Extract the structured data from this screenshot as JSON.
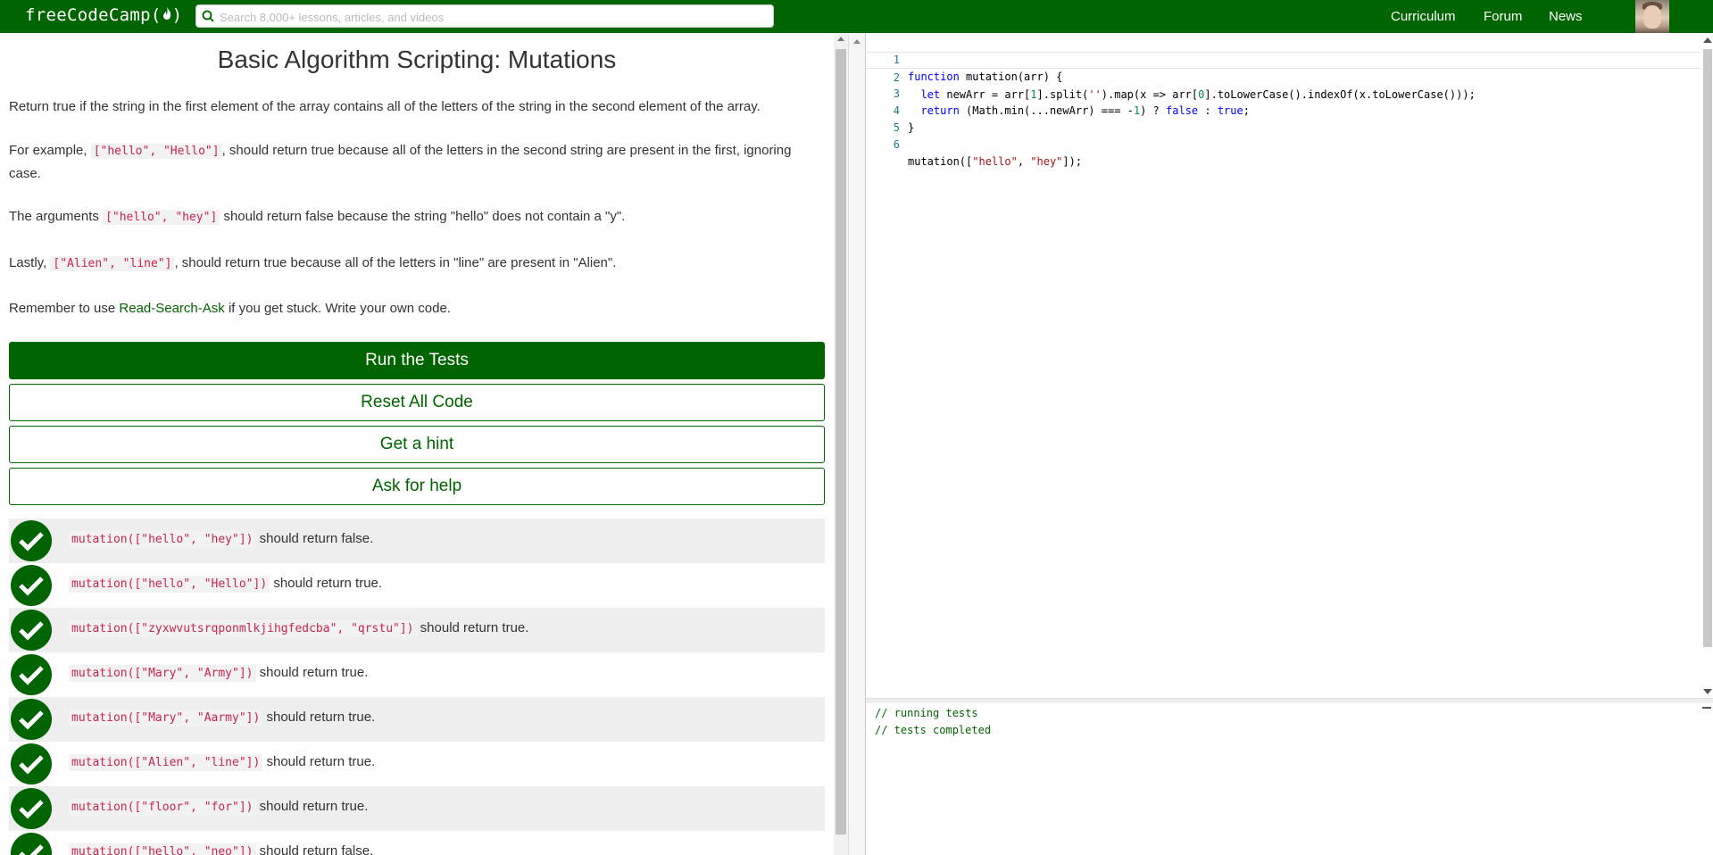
{
  "nav": {
    "logo_text": "freeCodeCamp(",
    "logo_suffix": ")",
    "search_placeholder": "Search 8,000+ lessons, articles, and videos",
    "links": [
      "Curriculum",
      "Forum",
      "News"
    ]
  },
  "challenge": {
    "title": "Basic Algorithm Scripting: Mutations",
    "p1": "Return true if the string in the first element of the array contains all of the letters of the string in the second element of the array.",
    "p2_pre": "For example, ",
    "p2_code": "[\"hello\", \"Hello\"]",
    "p2_post": ", should return true because all of the letters in the second string are present in the first, ignoring case.",
    "p3_pre": "The arguments ",
    "p3_code": "[\"hello\", \"hey\"]",
    "p3_post": " should return false because the string \"hello\" does not contain a \"y\".",
    "p4_pre": "Lastly, ",
    "p4_code": "[\"Alien\", \"line\"]",
    "p4_post": ", should return true because all of the letters in \"line\" are present in \"Alien\".",
    "p5_pre": "Remember to use ",
    "p5_link": "Read-Search-Ask",
    "p5_post": " if you get stuck. Write your own code."
  },
  "buttons": {
    "run": "Run the Tests",
    "reset": "Reset All Code",
    "hint": "Get a hint",
    "help": "Ask for help"
  },
  "tests": [
    {
      "code": "mutation([\"hello\", \"hey\"])",
      "text": " should return false."
    },
    {
      "code": "mutation([\"hello\", \"Hello\"])",
      "text": " should return true."
    },
    {
      "code": "mutation([\"zyxwvutsrqponmlkjihgfedcba\", \"qrstu\"])",
      "text": " should return true."
    },
    {
      "code": "mutation([\"Mary\", \"Army\"])",
      "text": " should return true."
    },
    {
      "code": "mutation([\"Mary\", \"Aarmy\"])",
      "text": " should return true."
    },
    {
      "code": "mutation([\"Alien\", \"line\"])",
      "text": " should return true."
    },
    {
      "code": "mutation([\"floor\", \"for\"])",
      "text": " should return true."
    },
    {
      "code": "mutation([\"hello\", \"neo\"])",
      "text": " should return false."
    }
  ],
  "editor": {
    "line_numbers": [
      "1",
      "2",
      "3",
      "4",
      "5",
      "6"
    ],
    "l1_kw": "function",
    "l1_rest": " mutation(arr) {",
    "l2_kw": "  let",
    "l2_a": " newArr = arr[",
    "l2_n1": "1",
    "l2_b": "].split(",
    "l2_s1": "''",
    "l2_c": ").map(x => arr[",
    "l2_n2": "0",
    "l2_d": "].toLowerCase().indexOf(x.toLowerCase()));",
    "l3_kw": "  return",
    "l3_a": " (Math.min(...newArr) === -",
    "l3_n": "1",
    "l3_b": ") ? ",
    "l3_f": "false",
    "l3_c": " : ",
    "l3_t": "true",
    "l3_d": ";",
    "l4": "}",
    "l5": "",
    "l6_a": "mutation([",
    "l6_s1": "\"hello\"",
    "l6_b": ", ",
    "l6_s2": "\"hey\"",
    "l6_c": "]);"
  },
  "output": {
    "lines": [
      "// running tests",
      "// tests completed"
    ]
  },
  "colors": {
    "brand": "#006400",
    "code_inline": "#c7254e"
  }
}
